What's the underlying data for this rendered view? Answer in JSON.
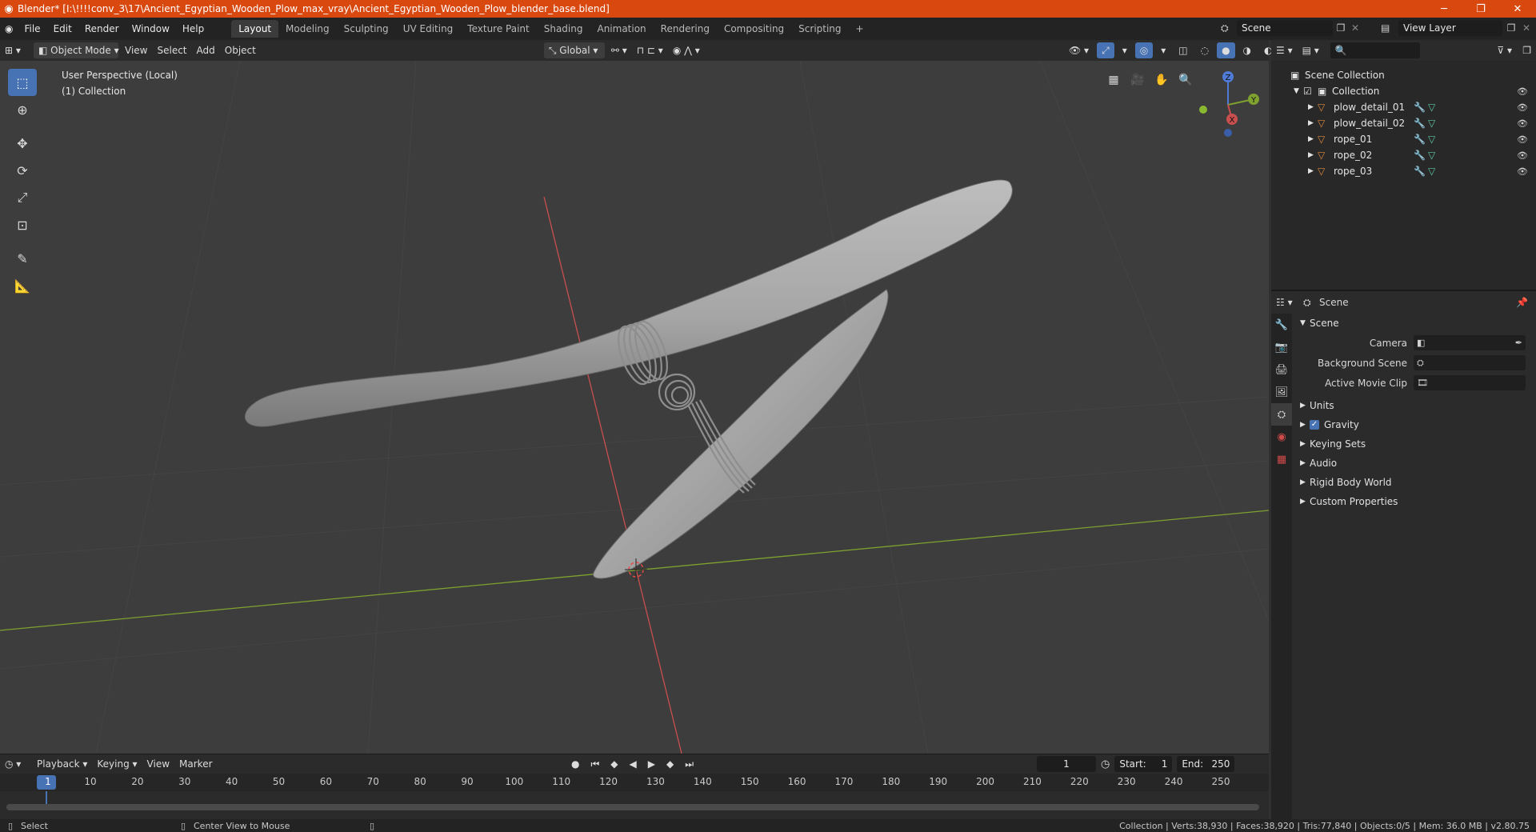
{
  "window": {
    "title": "Blender* [I:\\!!!!conv_3\\17\\Ancient_Egyptian_Wooden_Plow_max_vray\\Ancient_Egyptian_Wooden_Plow_blender_base.blend]",
    "minimize": "─",
    "restore": "❐",
    "close": "✕"
  },
  "menus": [
    "File",
    "Edit",
    "Render",
    "Window",
    "Help"
  ],
  "workspaces": [
    "Layout",
    "Modeling",
    "Sculpting",
    "UV Editing",
    "Texture Paint",
    "Shading",
    "Animation",
    "Rendering",
    "Compositing",
    "Scripting"
  ],
  "active_workspace": "Layout",
  "add_workspace": "+",
  "scene_field": "Scene",
  "view_layer_field": "View Layer",
  "viewport_header": {
    "mode": "Object Mode",
    "menu": [
      "View",
      "Select",
      "Add",
      "Object"
    ],
    "transform_orientation": "Global"
  },
  "viewport": {
    "perspective": "User Perspective (Local)",
    "collection": "(1) Collection",
    "gizmo_axes": {
      "z": "Z",
      "y": "Y",
      "x": "X"
    }
  },
  "timeline": {
    "menu": [
      "Playback",
      "Keying",
      "View",
      "Marker"
    ],
    "current_frame": "1",
    "start_label": "Start:",
    "start": "1",
    "end_label": "End:",
    "end": "250",
    "ticks": [
      "1",
      "10",
      "20",
      "30",
      "40",
      "50",
      "60",
      "70",
      "80",
      "90",
      "100",
      "110",
      "120",
      "130",
      "140",
      "150",
      "160",
      "170",
      "180",
      "190",
      "200",
      "210",
      "220",
      "230",
      "240",
      "250"
    ]
  },
  "statusbar": {
    "select": "Select",
    "center_view": "Center View to Mouse",
    "stats": "Collection | Verts:38,930 | Faces:38,920 | Tris:77,840 | Objects:0/5 | Mem: 36.0 MB | v2.80.75"
  },
  "outliner": {
    "scene_collection": "Scene Collection",
    "collection": "Collection",
    "objects": [
      "plow_detail_01",
      "plow_detail_02",
      "rope_01",
      "rope_02",
      "rope_03"
    ]
  },
  "properties": {
    "header": "Scene",
    "section": "Scene",
    "fields": [
      {
        "label": "Camera"
      },
      {
        "label": "Background Scene"
      },
      {
        "label": "Active Movie Clip"
      }
    ],
    "subsections": [
      "Units",
      "Gravity",
      "Keying Sets",
      "Audio",
      "Rigid Body World",
      "Custom Properties"
    ]
  },
  "colors": {
    "titlebar": "#d9480f",
    "accent": "#4772b3",
    "x_axis": "#c94f4f",
    "y_axis": "#7ea12f"
  }
}
